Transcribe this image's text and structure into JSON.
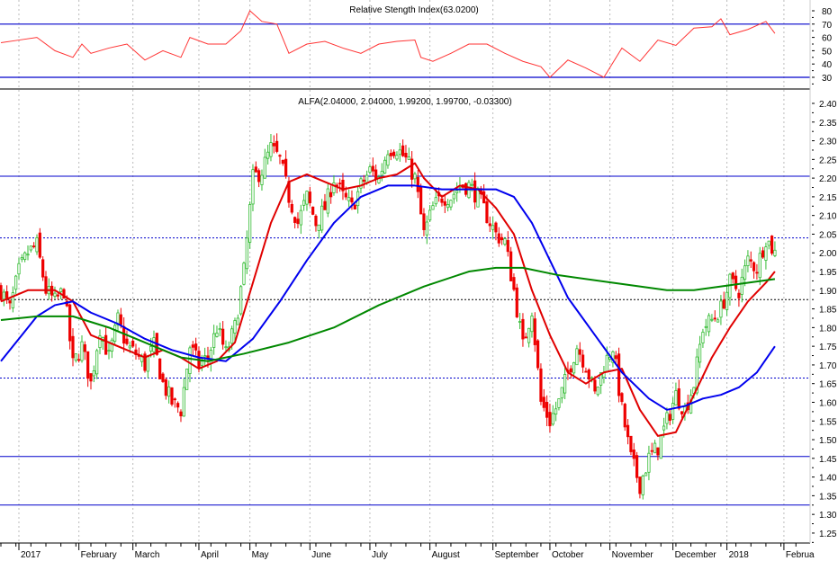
{
  "chart_data": [
    {
      "type": "line",
      "title": "Relative Stength Index(63.0200)",
      "y_ticks": [
        80,
        70,
        60,
        50,
        40,
        30
      ],
      "ylim": [
        20,
        85
      ],
      "reference_lines": [
        70,
        30
      ],
      "rsi": [
        [
          0,
          56
        ],
        [
          6,
          58
        ],
        [
          12,
          60
        ],
        [
          18,
          50
        ],
        [
          24,
          45
        ],
        [
          27,
          55
        ],
        [
          30,
          48
        ],
        [
          36,
          52
        ],
        [
          42,
          55
        ],
        [
          48,
          43
        ],
        [
          54,
          50
        ],
        [
          60,
          45
        ],
        [
          63,
          60
        ],
        [
          69,
          55
        ],
        [
          75,
          55
        ],
        [
          80,
          65
        ],
        [
          83,
          80
        ],
        [
          87,
          72
        ],
        [
          92,
          70
        ],
        [
          96,
          48
        ],
        [
          102,
          55
        ],
        [
          108,
          57
        ],
        [
          114,
          52
        ],
        [
          120,
          48
        ],
        [
          126,
          55
        ],
        [
          132,
          57
        ],
        [
          138,
          58
        ],
        [
          140,
          45
        ],
        [
          144,
          42
        ],
        [
          150,
          48
        ],
        [
          156,
          55
        ],
        [
          162,
          55
        ],
        [
          168,
          48
        ],
        [
          174,
          42
        ],
        [
          180,
          38
        ],
        [
          183,
          30
        ],
        [
          189,
          43
        ],
        [
          195,
          37
        ],
        [
          201,
          30
        ],
        [
          207,
          52
        ],
        [
          213,
          42
        ],
        [
          219,
          58
        ],
        [
          225,
          54
        ],
        [
          231,
          67
        ],
        [
          237,
          68
        ],
        [
          240,
          74
        ],
        [
          243,
          62
        ],
        [
          249,
          66
        ],
        [
          255,
          72
        ],
        [
          258,
          63
        ]
      ]
    },
    {
      "type": "candlestick",
      "title": "ALFA(2.04000, 2.04000, 1.99200, 1.99700, -0.03300)",
      "y_ticks": [
        "2.40",
        "2.35",
        "2.30",
        "2.25",
        "2.20",
        "2.15",
        "2.10",
        "2.05",
        "2.00",
        "1.95",
        "1.90",
        "1.85",
        "1.80",
        "1.75",
        "1.70",
        "1.65",
        "1.60",
        "1.55",
        "1.50",
        "1.45",
        "1.40",
        "1.35",
        "1.30",
        "1.25"
      ],
      "ylim": [
        1.22,
        2.42
      ],
      "x_labels": [
        [
          "2017",
          6
        ],
        [
          "February",
          26
        ],
        [
          "March",
          44
        ],
        [
          "April",
          66
        ],
        [
          "May",
          83
        ],
        [
          "June",
          103
        ],
        [
          "July",
          123
        ],
        [
          "August",
          143
        ],
        [
          "September",
          164
        ],
        [
          "October",
          183
        ],
        [
          "November",
          203
        ],
        [
          "December",
          224
        ],
        [
          "2018",
          242
        ],
        [
          "Februa",
          261
        ]
      ],
      "sessions_per_close_sample": 3,
      "closes": [
        1.9,
        1.85,
        1.95,
        2.0,
        2.02,
        1.9,
        1.87,
        1.9,
        1.7,
        1.75,
        1.65,
        1.8,
        1.72,
        1.82,
        1.75,
        1.73,
        1.7,
        1.75,
        1.65,
        1.6,
        1.58,
        1.75,
        1.7,
        1.72,
        1.8,
        1.73,
        1.8,
        1.95,
        2.2,
        2.22,
        2.28,
        2.25,
        2.15,
        2.08,
        2.15,
        2.08,
        2.12,
        2.2,
        2.15,
        2.12,
        2.18,
        2.22,
        2.2,
        2.28,
        2.28,
        2.25,
        2.2,
        2.05,
        2.12,
        2.15,
        2.15,
        2.18,
        2.18,
        2.15,
        2.1,
        2.05,
        2.03,
        1.9,
        1.75,
        1.85,
        1.6,
        1.55,
        1.6,
        1.68,
        1.75,
        1.7,
        1.62,
        1.7,
        1.75,
        1.58,
        1.45,
        1.38,
        1.45,
        1.48,
        1.55,
        1.62,
        1.58,
        1.65,
        1.8,
        1.82,
        1.85,
        1.92,
        1.9,
        1.98,
        1.96,
        2.04,
        2.0
      ],
      "horizontal_lines": [
        {
          "value": 2.205,
          "style": "solid",
          "color": "#0000cc"
        },
        {
          "value": 2.04,
          "style": "dotted",
          "color": "#0000cc"
        },
        {
          "value": 1.875,
          "style": "dotted",
          "color": "#000000"
        },
        {
          "value": 1.665,
          "style": "dotted",
          "color": "#0000cc"
        },
        {
          "value": 1.455,
          "style": "solid",
          "color": "#0000cc"
        },
        {
          "value": 1.325,
          "style": "solid",
          "color": "#0000cc"
        }
      ],
      "series": [
        {
          "name": "ma-short",
          "color": "#e00000",
          "points": [
            [
              0,
              1.87
            ],
            [
              9,
              1.9
            ],
            [
              18,
              1.9
            ],
            [
              24,
              1.87
            ],
            [
              30,
              1.78
            ],
            [
              36,
              1.76
            ],
            [
              42,
              1.74
            ],
            [
              48,
              1.72
            ],
            [
              54,
              1.74
            ],
            [
              60,
              1.72
            ],
            [
              66,
              1.69
            ],
            [
              72,
              1.71
            ],
            [
              78,
              1.76
            ],
            [
              84,
              1.92
            ],
            [
              90,
              2.08
            ],
            [
              96,
              2.19
            ],
            [
              102,
              2.21
            ],
            [
              108,
              2.19
            ],
            [
              114,
              2.17
            ],
            [
              120,
              2.18
            ],
            [
              126,
              2.2
            ],
            [
              132,
              2.21
            ],
            [
              138,
              2.24
            ],
            [
              141,
              2.2
            ],
            [
              147,
              2.15
            ],
            [
              153,
              2.18
            ],
            [
              159,
              2.17
            ],
            [
              165,
              2.12
            ],
            [
              171,
              2.05
            ],
            [
              177,
              1.9
            ],
            [
              183,
              1.78
            ],
            [
              189,
              1.68
            ],
            [
              195,
              1.65
            ],
            [
              201,
              1.68
            ],
            [
              207,
              1.69
            ],
            [
              213,
              1.58
            ],
            [
              219,
              1.51
            ],
            [
              225,
              1.52
            ],
            [
              231,
              1.62
            ],
            [
              237,
              1.72
            ],
            [
              243,
              1.8
            ],
            [
              249,
              1.87
            ],
            [
              255,
              1.92
            ],
            [
              258,
              1.95
            ]
          ]
        },
        {
          "name": "ma-medium",
          "color": "#0000ee",
          "points": [
            [
              0,
              1.71
            ],
            [
              6,
              1.77
            ],
            [
              12,
              1.83
            ],
            [
              18,
              1.86
            ],
            [
              24,
              1.87
            ],
            [
              30,
              1.84
            ],
            [
              39,
              1.81
            ],
            [
              48,
              1.77
            ],
            [
              57,
              1.74
            ],
            [
              66,
              1.72
            ],
            [
              75,
              1.71
            ],
            [
              84,
              1.77
            ],
            [
              93,
              1.87
            ],
            [
              102,
              1.98
            ],
            [
              111,
              2.08
            ],
            [
              120,
              2.15
            ],
            [
              129,
              2.18
            ],
            [
              138,
              2.18
            ],
            [
              147,
              2.17
            ],
            [
              156,
              2.17
            ],
            [
              165,
              2.17
            ],
            [
              171,
              2.15
            ],
            [
              177,
              2.08
            ],
            [
              183,
              1.98
            ],
            [
              189,
              1.88
            ],
            [
              198,
              1.78
            ],
            [
              207,
              1.68
            ],
            [
              216,
              1.61
            ],
            [
              222,
              1.58
            ],
            [
              228,
              1.59
            ],
            [
              234,
              1.61
            ],
            [
              240,
              1.62
            ],
            [
              246,
              1.64
            ],
            [
              252,
              1.68
            ],
            [
              258,
              1.75
            ]
          ]
        },
        {
          "name": "ma-long",
          "color": "#008800",
          "points": [
            [
              0,
              1.82
            ],
            [
              12,
              1.83
            ],
            [
              24,
              1.83
            ],
            [
              36,
              1.8
            ],
            [
              48,
              1.76
            ],
            [
              60,
              1.72
            ],
            [
              69,
              1.71
            ],
            [
              81,
              1.73
            ],
            [
              96,
              1.76
            ],
            [
              111,
              1.8
            ],
            [
              126,
              1.86
            ],
            [
              141,
              1.91
            ],
            [
              156,
              1.95
            ],
            [
              165,
              1.96
            ],
            [
              174,
              1.96
            ],
            [
              186,
              1.94
            ],
            [
              204,
              1.92
            ],
            [
              222,
              1.9
            ],
            [
              231,
              1.9
            ],
            [
              240,
              1.91
            ],
            [
              249,
              1.92
            ],
            [
              258,
              1.93
            ]
          ]
        }
      ]
    }
  ]
}
